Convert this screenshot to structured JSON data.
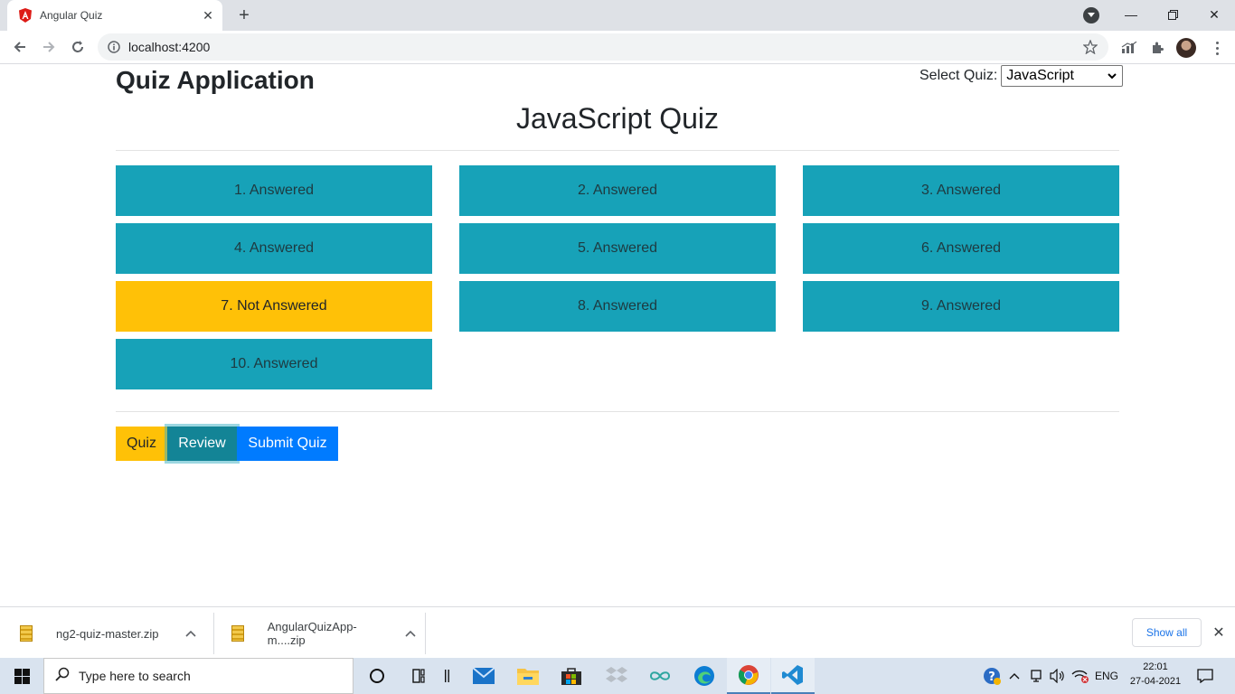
{
  "browser": {
    "tab_title": "Angular Quiz",
    "url": "localhost:4200"
  },
  "page": {
    "app_title": "Quiz Application",
    "select_label": "Select Quiz:",
    "select_value": "JavaScript",
    "quiz_heading": "JavaScript Quiz",
    "questions": [
      {
        "label": "1. Answered",
        "status": "answered"
      },
      {
        "label": "2. Answered",
        "status": "answered"
      },
      {
        "label": "3. Answered",
        "status": "answered"
      },
      {
        "label": "4. Answered",
        "status": "answered"
      },
      {
        "label": "5. Answered",
        "status": "answered"
      },
      {
        "label": "6. Answered",
        "status": "answered"
      },
      {
        "label": "7. Not Answered",
        "status": "not-answered"
      },
      {
        "label": "8. Answered",
        "status": "answered"
      },
      {
        "label": "9. Answered",
        "status": "answered"
      },
      {
        "label": "10. Answered",
        "status": "answered"
      }
    ],
    "actions": {
      "quiz": "Quiz",
      "review": "Review",
      "submit": "Submit Quiz"
    },
    "colors": {
      "answered": "#17a2b8",
      "not_answered": "#ffc107",
      "submit": "#007bff"
    }
  },
  "downloads": {
    "items": [
      "ng2-quiz-master.zip",
      "AngularQuizApp-m....zip"
    ],
    "show_all": "Show all"
  },
  "taskbar": {
    "search_placeholder": "Type here to search",
    "language": "ENG",
    "time": "22:01",
    "date": "27-04-2021"
  }
}
